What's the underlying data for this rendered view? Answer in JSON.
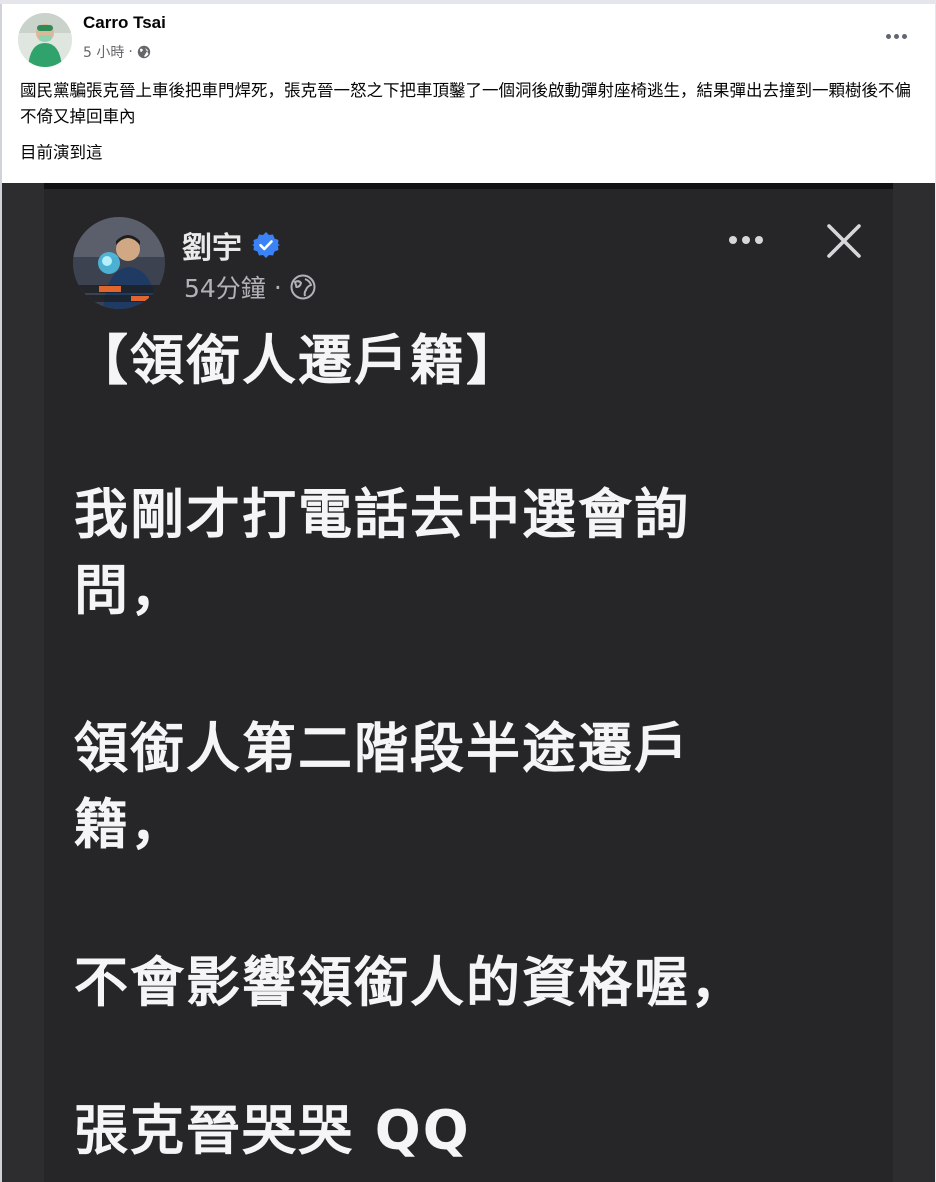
{
  "post": {
    "author": "Carro Tsai",
    "time": "5 小時",
    "separator": "·",
    "text_line1": "國民黨騙張克晉上車後把車門焊死，張克晉一怒之下把車頂鑿了一個洞後啟動彈射座椅逃生，結果彈出去撞到一顆樹後不偏不倚又掉回車內",
    "text_line2": "目前演到這",
    "privacy_icon": "globe-icon",
    "more_icon": "more-horizontal-icon"
  },
  "embedded": {
    "author": "劉宇",
    "verified_icon": "verified-badge-icon",
    "time": "54分鐘",
    "separator": "·",
    "privacy_icon": "globe-icon",
    "more_icon": "more-horizontal-icon",
    "close_icon": "close-icon",
    "lines": [
      "【領銜人遷戶籍】",
      "我剛才打電話去中選會詢",
      "問，",
      "領銜人第二階段半途遷戶",
      "籍，",
      "不會影響領銜人的資格喔，",
      "張克晉哭哭 QQ"
    ],
    "colors": {
      "background": "#262628",
      "text": "#f5f5f7",
      "verified": "#3b82f6"
    }
  }
}
